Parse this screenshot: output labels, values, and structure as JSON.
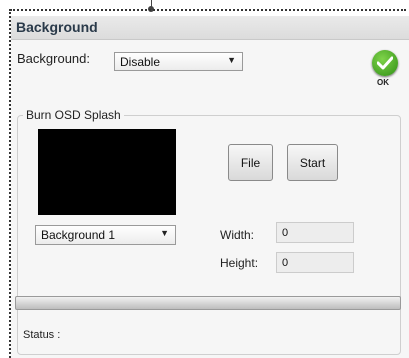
{
  "window": {
    "title": "Background"
  },
  "background": {
    "label": "Background:",
    "selected": "Disable"
  },
  "ok_button": {
    "label": "OK",
    "color": "#3aa01e"
  },
  "splash": {
    "group_title": "Burn OSD Splash",
    "image_select": "Background 1",
    "file_label": "File",
    "start_label": "Start",
    "width_label": "Width:",
    "width_value": "0",
    "height_label": "Height:",
    "height_value": "0"
  },
  "progress": {
    "value_percent": 0
  },
  "status": {
    "label": "Status :"
  }
}
